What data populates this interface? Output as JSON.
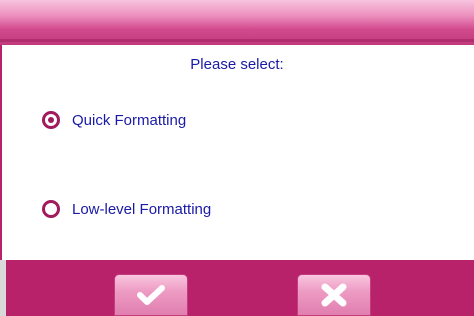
{
  "dialog": {
    "prompt": "Please select:",
    "options": [
      {
        "label": "Quick Formatting",
        "selected": true
      },
      {
        "label": "Low-level Formatting",
        "selected": false
      }
    ],
    "buttons": {
      "confirm_icon": "checkmark-icon",
      "cancel_icon": "cross-icon"
    }
  },
  "colors": {
    "accent": "#b7226a",
    "text": "#1a1aa8",
    "button": "#ee9cc4"
  }
}
